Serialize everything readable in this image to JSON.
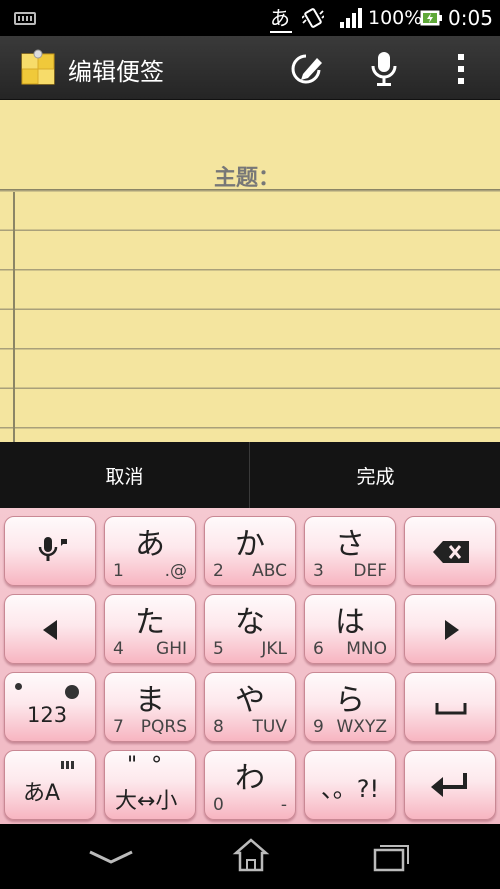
{
  "status_bar": {
    "keyboard_icon": "keyboard-icon",
    "ime_indicator": "あ",
    "vibrate_icon": "vibrate-icon",
    "signal_icon": "signal-icon",
    "battery_percent": "100%",
    "battery_icon": "battery-charging-icon",
    "time": "0:05"
  },
  "action_bar": {
    "title": "编辑便签",
    "logo_icon": "sticky-note-icon",
    "edit_icon": "pen-edit-icon",
    "mic_icon": "microphone-icon",
    "more_icon": "overflow-menu-icon"
  },
  "note": {
    "subject_label": "主题："
  },
  "buttons": {
    "cancel": "取消",
    "done": "完成"
  },
  "keyboard": {
    "row1": [
      {
        "name": "voice-input-key",
        "icon": "microphone-icon"
      },
      {
        "kana": "あ",
        "num": "1",
        "letters": ".@"
      },
      {
        "kana": "か",
        "num": "2",
        "letters": "ABC"
      },
      {
        "kana": "さ",
        "num": "3",
        "letters": "DEF"
      },
      {
        "name": "backspace-key",
        "icon": "backspace-icon"
      }
    ],
    "row2": [
      {
        "name": "left-arrow-key",
        "icon": "left-arrow-icon"
      },
      {
        "kana": "た",
        "num": "4",
        "letters": "GHI"
      },
      {
        "kana": "な",
        "num": "5",
        "letters": "JKL"
      },
      {
        "kana": "は",
        "num": "6",
        "letters": "MNO"
      },
      {
        "name": "right-arrow-key",
        "icon": "right-arrow-icon"
      }
    ],
    "row3": [
      {
        "name": "mode-123-key",
        "label": "123"
      },
      {
        "kana": "ま",
        "num": "7",
        "letters": "PQRS"
      },
      {
        "kana": "や",
        "num": "8",
        "letters": "TUV"
      },
      {
        "kana": "ら",
        "num": "9",
        "letters": "WXYZ"
      },
      {
        "name": "space-key",
        "icon": "space-icon"
      }
    ],
    "row4": [
      {
        "name": "input-mode-key",
        "label": "あA"
      },
      {
        "name": "dakuten-key",
        "top": "\"  °",
        "label": "大↔小"
      },
      {
        "kana": "わ",
        "num": "0",
        "letters": "-"
      },
      {
        "name": "punctuation-key",
        "label": "、。?!"
      },
      {
        "name": "enter-key",
        "icon": "enter-icon"
      }
    ]
  },
  "nav_bar": {
    "back_icon": "back-icon",
    "home_icon": "home-icon",
    "recent_icon": "recent-apps-icon"
  }
}
